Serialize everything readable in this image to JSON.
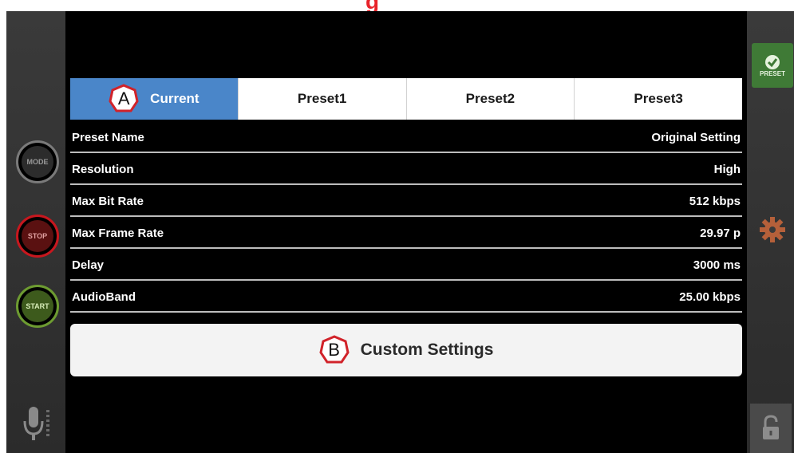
{
  "banner": {
    "partial_text": "g"
  },
  "left_bar": {
    "mode_label": "MODE",
    "stop_label": "STOP",
    "start_label": "START",
    "mic_icon": "microphone-icon"
  },
  "tabs": [
    {
      "badge": "A",
      "label": "Current",
      "active": true
    },
    {
      "label": "Preset1"
    },
    {
      "label": "Preset2"
    },
    {
      "label": "Preset3"
    }
  ],
  "rows": [
    {
      "label": "Preset Name",
      "value": "Original Setting"
    },
    {
      "label": "Resolution",
      "value": "High"
    },
    {
      "label": "Max Bit Rate",
      "value": "512 kbps"
    },
    {
      "label": "Max Frame Rate",
      "value": "29.97 p"
    },
    {
      "label": "Delay",
      "value": "3000 ms"
    },
    {
      "label": "AudioBand",
      "value": "25.00 kbps"
    }
  ],
  "custom": {
    "badge": "B",
    "label": "Custom Settings"
  },
  "right_bar": {
    "preset_label": "PRESET",
    "preset_icon": "check-icon",
    "gear_icon": "gear-icon",
    "lock_icon": "lock-icon"
  },
  "colors": {
    "active_tab": "#4a86c9",
    "preset_button": "#3f7a36",
    "stop": "#c7171e",
    "start": "#6d9b31",
    "gear": "#b5603a"
  }
}
